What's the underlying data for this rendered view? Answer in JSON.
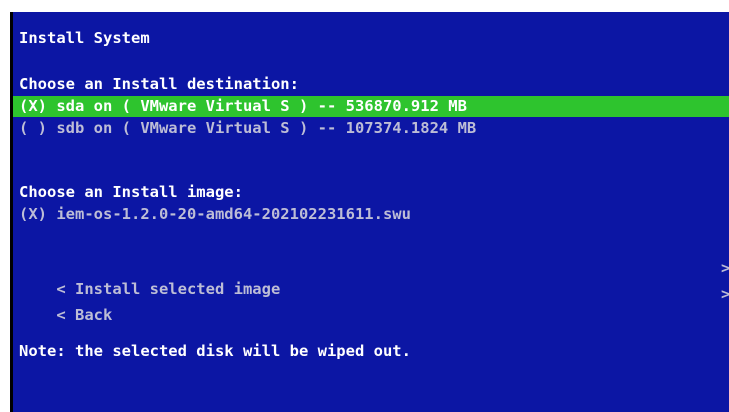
{
  "window": {
    "title": "Install System"
  },
  "destination": {
    "heading": "Choose an Install destination:",
    "options": [
      {
        "label": "(X) sda on ( VMware Virtual S ) -- 536870.912 MB",
        "selected": true
      },
      {
        "label": "( ) sdb on ( VMware Virtual S ) -- 107374.1824 MB",
        "selected": false
      }
    ]
  },
  "image": {
    "heading": "Choose an Install image:",
    "options": [
      {
        "label": "(X) iem-os-1.2.0-20-amd64-202102231611.swu",
        "selected": false
      }
    ]
  },
  "actions": {
    "install": "< Install selected image",
    "back": "< Back",
    "install_end": ">",
    "back_end": ">"
  },
  "note": "Note: the selected disk will be wiped out.",
  "colors": {
    "background": "#0c16a4",
    "highlight": "#2ec42e",
    "text": "#ffffff",
    "text_dim": "#bdbdd6"
  }
}
